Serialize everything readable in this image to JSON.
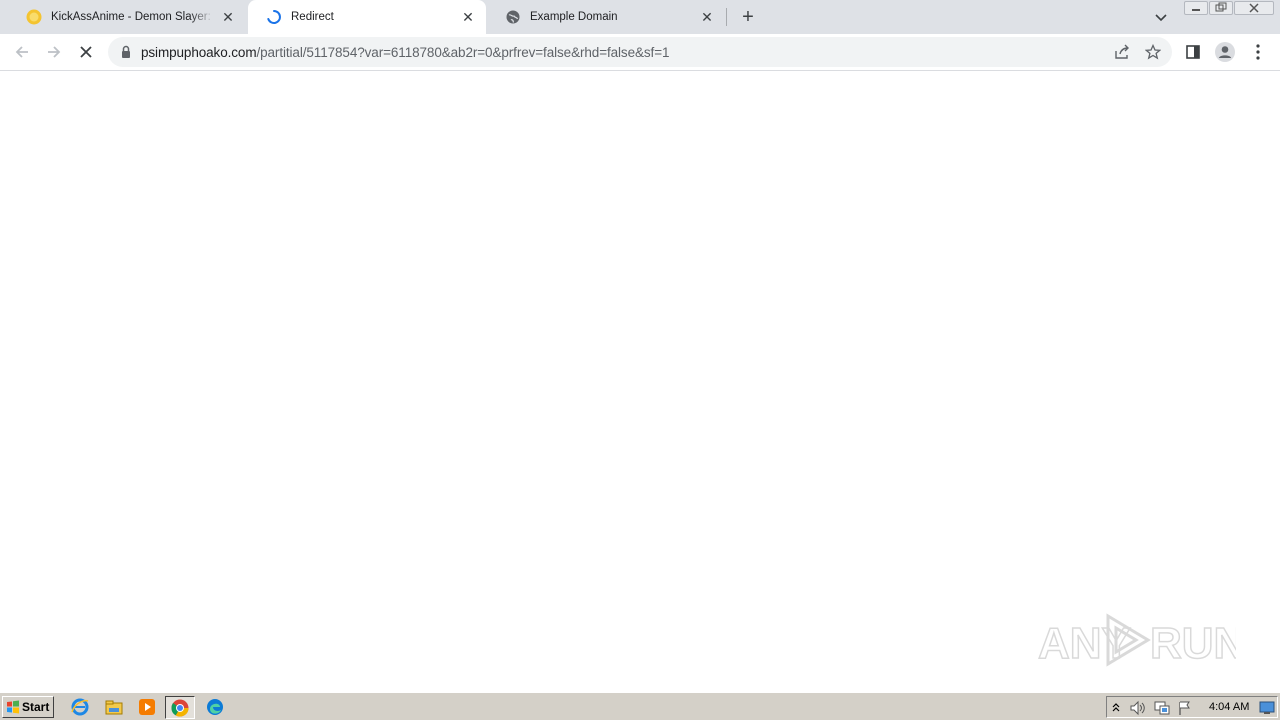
{
  "tabs": [
    {
      "title": "KickAssAnime - Demon Slayer: Kimetsu no Yaiba - Swordsmith Village Arc",
      "favicon": "kickassanime-favicon",
      "active": false
    },
    {
      "title": "Redirect",
      "favicon": "loading-spinner-icon",
      "active": true
    },
    {
      "title": "Example Domain",
      "favicon": "globe-icon",
      "active": false
    }
  ],
  "new_tab_label": "+",
  "address_bar": {
    "host": "psimpuphoako.com",
    "path": "/partitial/5117854?var=6118780&ab2r=0&prfrev=false&rhd=false&sf=1"
  },
  "watermark": {
    "text_left": "ANY",
    "text_right": "RUN"
  },
  "taskbar": {
    "start_label": "Start",
    "clock": "4:04 AM"
  },
  "colors": {
    "tabstrip": "#dee1e6",
    "omnibox": "#f1f3f4",
    "spinner": "#1a73e8",
    "taskbar": "#d4d0c8"
  }
}
